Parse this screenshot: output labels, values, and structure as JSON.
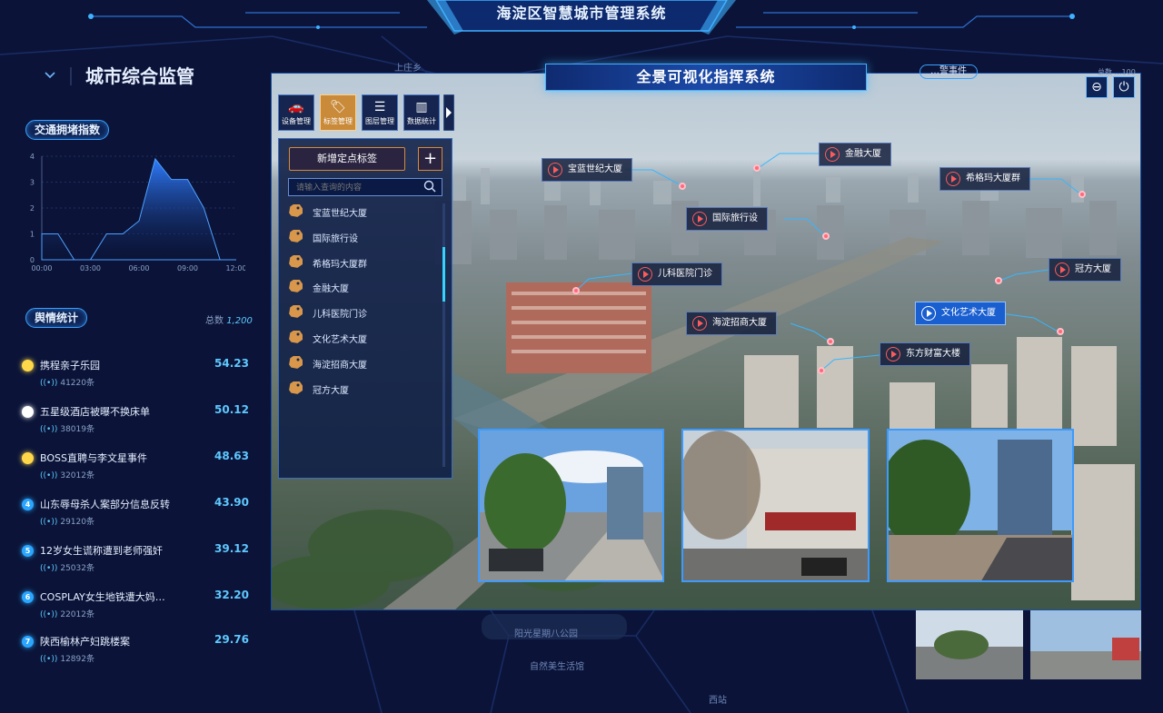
{
  "header": {
    "title": "海淀区智慧城市管理系统"
  },
  "left_panel": {
    "title": "城市综合监管",
    "traffic": {
      "title": "交通拥堵指数",
      "chart_data": {
        "type": "area",
        "x": [
          "00:00",
          "01:00",
          "02:00",
          "03:00",
          "04:00",
          "05:00",
          "06:00",
          "07:00",
          "08:00",
          "09:00",
          "10:00",
          "11:00",
          "12:00"
        ],
        "values": [
          1,
          1,
          0,
          0,
          1,
          1,
          1.5,
          3.9,
          3.1,
          3.1,
          2,
          0,
          0
        ],
        "x_ticks": [
          "00:00",
          "03:00",
          "06:00",
          "09:00",
          "12:00"
        ],
        "y_ticks": [
          "0",
          "1",
          "2",
          "3",
          "4"
        ],
        "ylim": [
          0,
          4
        ],
        "color": "#2f7dff"
      }
    },
    "opinion": {
      "title": "舆情统计",
      "total_label": "总数",
      "total_value": "1,200",
      "items": [
        {
          "rank": "",
          "name": "携程亲子乐园",
          "value": "54.23",
          "count": "41220条",
          "color": "#ffd84a"
        },
        {
          "rank": "",
          "name": "五星级酒店被曝不换床单",
          "value": "50.12",
          "count": "38019条",
          "color": "#ffffff"
        },
        {
          "rank": "",
          "name": "BOSS直聘与李文星事件",
          "value": "48.63",
          "count": "32012条",
          "color": "#ffd84a"
        },
        {
          "rank": "4",
          "name": "山东辱母杀人案部分信息反转",
          "value": "43.90",
          "count": "29120条",
          "color": "#2aa6ff"
        },
        {
          "rank": "5",
          "name": "12岁女生谎称遭到老师强奸",
          "value": "39.12",
          "count": "25032条",
          "color": "#2aa6ff"
        },
        {
          "rank": "6",
          "name": "COSPLAY女生地铁遭大妈…",
          "value": "32.20",
          "count": "22012条",
          "color": "#2aa6ff"
        },
        {
          "rank": "7",
          "name": "陕西榆林产妇跳楼案",
          "value": "29.76",
          "count": "12892条",
          "color": "#2aa6ff"
        }
      ]
    }
  },
  "main": {
    "title": "全景可视化指挥系统",
    "controls": {
      "minimize": "⊖",
      "power": "⏻"
    },
    "toolbar": [
      {
        "label": "设备管理",
        "icon": "car-icon"
      },
      {
        "label": "标签管理",
        "icon": "tag-icon"
      },
      {
        "label": "图层管理",
        "icon": "layers-icon"
      },
      {
        "label": "数据统计",
        "icon": "bar-chart-icon"
      }
    ],
    "tag_panel": {
      "add_label": "新增定点标签",
      "add_plus": "+",
      "search_placeholder": "请输入查询的内容",
      "tags": [
        "宝蓝世纪大厦",
        "国际旅行设",
        "希格玛大厦群",
        "金融大厦",
        "儿科医院门诊",
        "文化艺术大厦",
        "海淀招商大厦",
        "冠方大厦"
      ]
    },
    "points": [
      {
        "label": "宝蓝世纪大厦"
      },
      {
        "label": "金融大厦"
      },
      {
        "label": "希格玛大厦群"
      },
      {
        "label": "国际旅行设"
      },
      {
        "label": "儿科医院门诊"
      },
      {
        "label": "冠方大厦"
      },
      {
        "label": "文化艺术大厦"
      },
      {
        "label": "海淀招商大厦"
      },
      {
        "label": "东方财富大楼"
      }
    ]
  },
  "right_stub": {
    "title": "…警事件",
    "total": "总数 …100"
  },
  "map_labels": [
    "上庄乡",
    "阳光星期八公园",
    "自然美生活馆",
    "西站"
  ]
}
